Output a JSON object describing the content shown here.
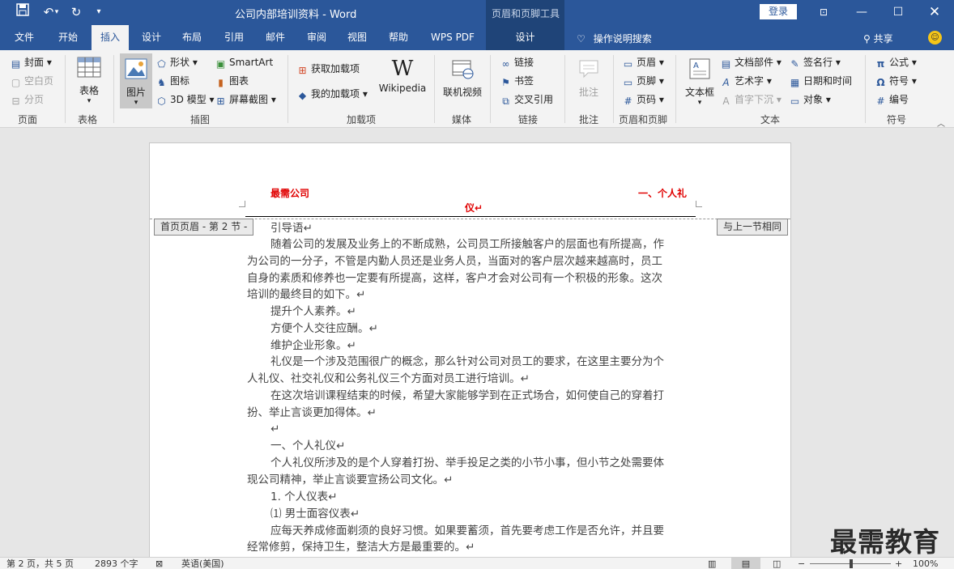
{
  "titlebar": {
    "title": "公司内部培训资料  -  Word",
    "context_tools": "页眉和页脚工具",
    "login": "登录",
    "icons": [
      "save-icon",
      "undo-icon",
      "redo-icon",
      "customize-qat-icon",
      "ribbon-display-icon",
      "minimize-icon",
      "maximize-icon",
      "close-icon"
    ]
  },
  "tabs": [
    "文件",
    "开始",
    "插入",
    "设计",
    "布局",
    "引用",
    "邮件",
    "审阅",
    "视图",
    "帮助",
    "WPS PDF",
    "设计"
  ],
  "active_tab": "插入",
  "tellme": "操作说明搜索",
  "share": "共享",
  "ribbon": {
    "pages": {
      "cover": "封面",
      "blank": "空白页",
      "break": "分页",
      "label": "页面"
    },
    "tables": {
      "table": "表格",
      "label": "表格"
    },
    "illustrations": {
      "picture": "图片",
      "shapes": "形状",
      "icons": "图标",
      "model3d": "3D 模型",
      "smartart": "SmartArt",
      "chart": "图表",
      "screenshot": "屏幕截图",
      "label": "插图"
    },
    "addins": {
      "get": "获取加载项",
      "my": "我的加载项",
      "wikipedia": "Wikipedia",
      "label": "加载项"
    },
    "media": {
      "video": "联机视频",
      "label": "媒体"
    },
    "links": {
      "link": "链接",
      "bookmark": "书签",
      "crossref": "交叉引用",
      "label": "链接"
    },
    "comments": {
      "comment": "批注",
      "label": "批注"
    },
    "headerfooter": {
      "header": "页眉",
      "footer": "页脚",
      "pagenum": "页码",
      "label": "页眉和页脚"
    },
    "text": {
      "textbox": "文本框",
      "quickparts": "文档部件",
      "wordart": "艺术字",
      "dropcap": "首字下沉",
      "signature": "签名行",
      "datetime": "日期和时间",
      "object": "对象",
      "label": "文本"
    },
    "symbols": {
      "equation": "公式",
      "symbol": "符号",
      "number": "编号",
      "label": "符号"
    }
  },
  "document": {
    "header_left": "最需公司",
    "header_right": "一、个人礼",
    "header_center": "仪↵",
    "header_tag_left": "首页页眉 - 第 2 节 -",
    "header_tag_right": "与上一节相同",
    "lines": [
      "引导语↵",
      "随着公司的发展及业务上的不断成熟，公司员工所接触客户的层面也有所提高，作",
      "为公司的一分子，不管是内勤人员还是业务人员，当面对的客户层次越来越高时，员工",
      "自身的素质和修养也一定要有所提高，这样，客户才会对公司有一个积极的形象。这次",
      "培训的最终目的如下。↵",
      "提升个人素养。↵",
      "方便个人交往应酬。↵",
      "维护企业形象。↵",
      "礼仪是一个涉及范围很广的概念，那么针对公司对员工的要求，在这里主要分为个",
      "人礼仪、社交礼仪和公务礼仪三个方面对员工进行培训。↵",
      "在这次培训课程结束的时候，希望大家能够学到在正式场合，如何使自己的穿着打",
      "扮、举止言谈更加得体。↵",
      "↵",
      "一、个人礼仪↵",
      "个人礼仪所涉及的是个人穿着打扮、举手投足之类的小节小事，但小节之处需要体",
      "现公司精神，举止言谈要宣扬公司文化。↵",
      "1.  个人仪表↵",
      "⑴ 男士面容仪表↵",
      "应每天养成修面剃须的良好习惯。如果要蓄须，首先要考虑工作是否允许，并且要",
      "经常修剪，保持卫生，整洁大方是最重要的。↵"
    ]
  },
  "watermark": "最需教育",
  "status": {
    "page": "第 2 页，共 5 页",
    "words": "2893 个字",
    "language": "英语(美国)",
    "zoom": "100%",
    "minus": "−",
    "plus": "+"
  }
}
